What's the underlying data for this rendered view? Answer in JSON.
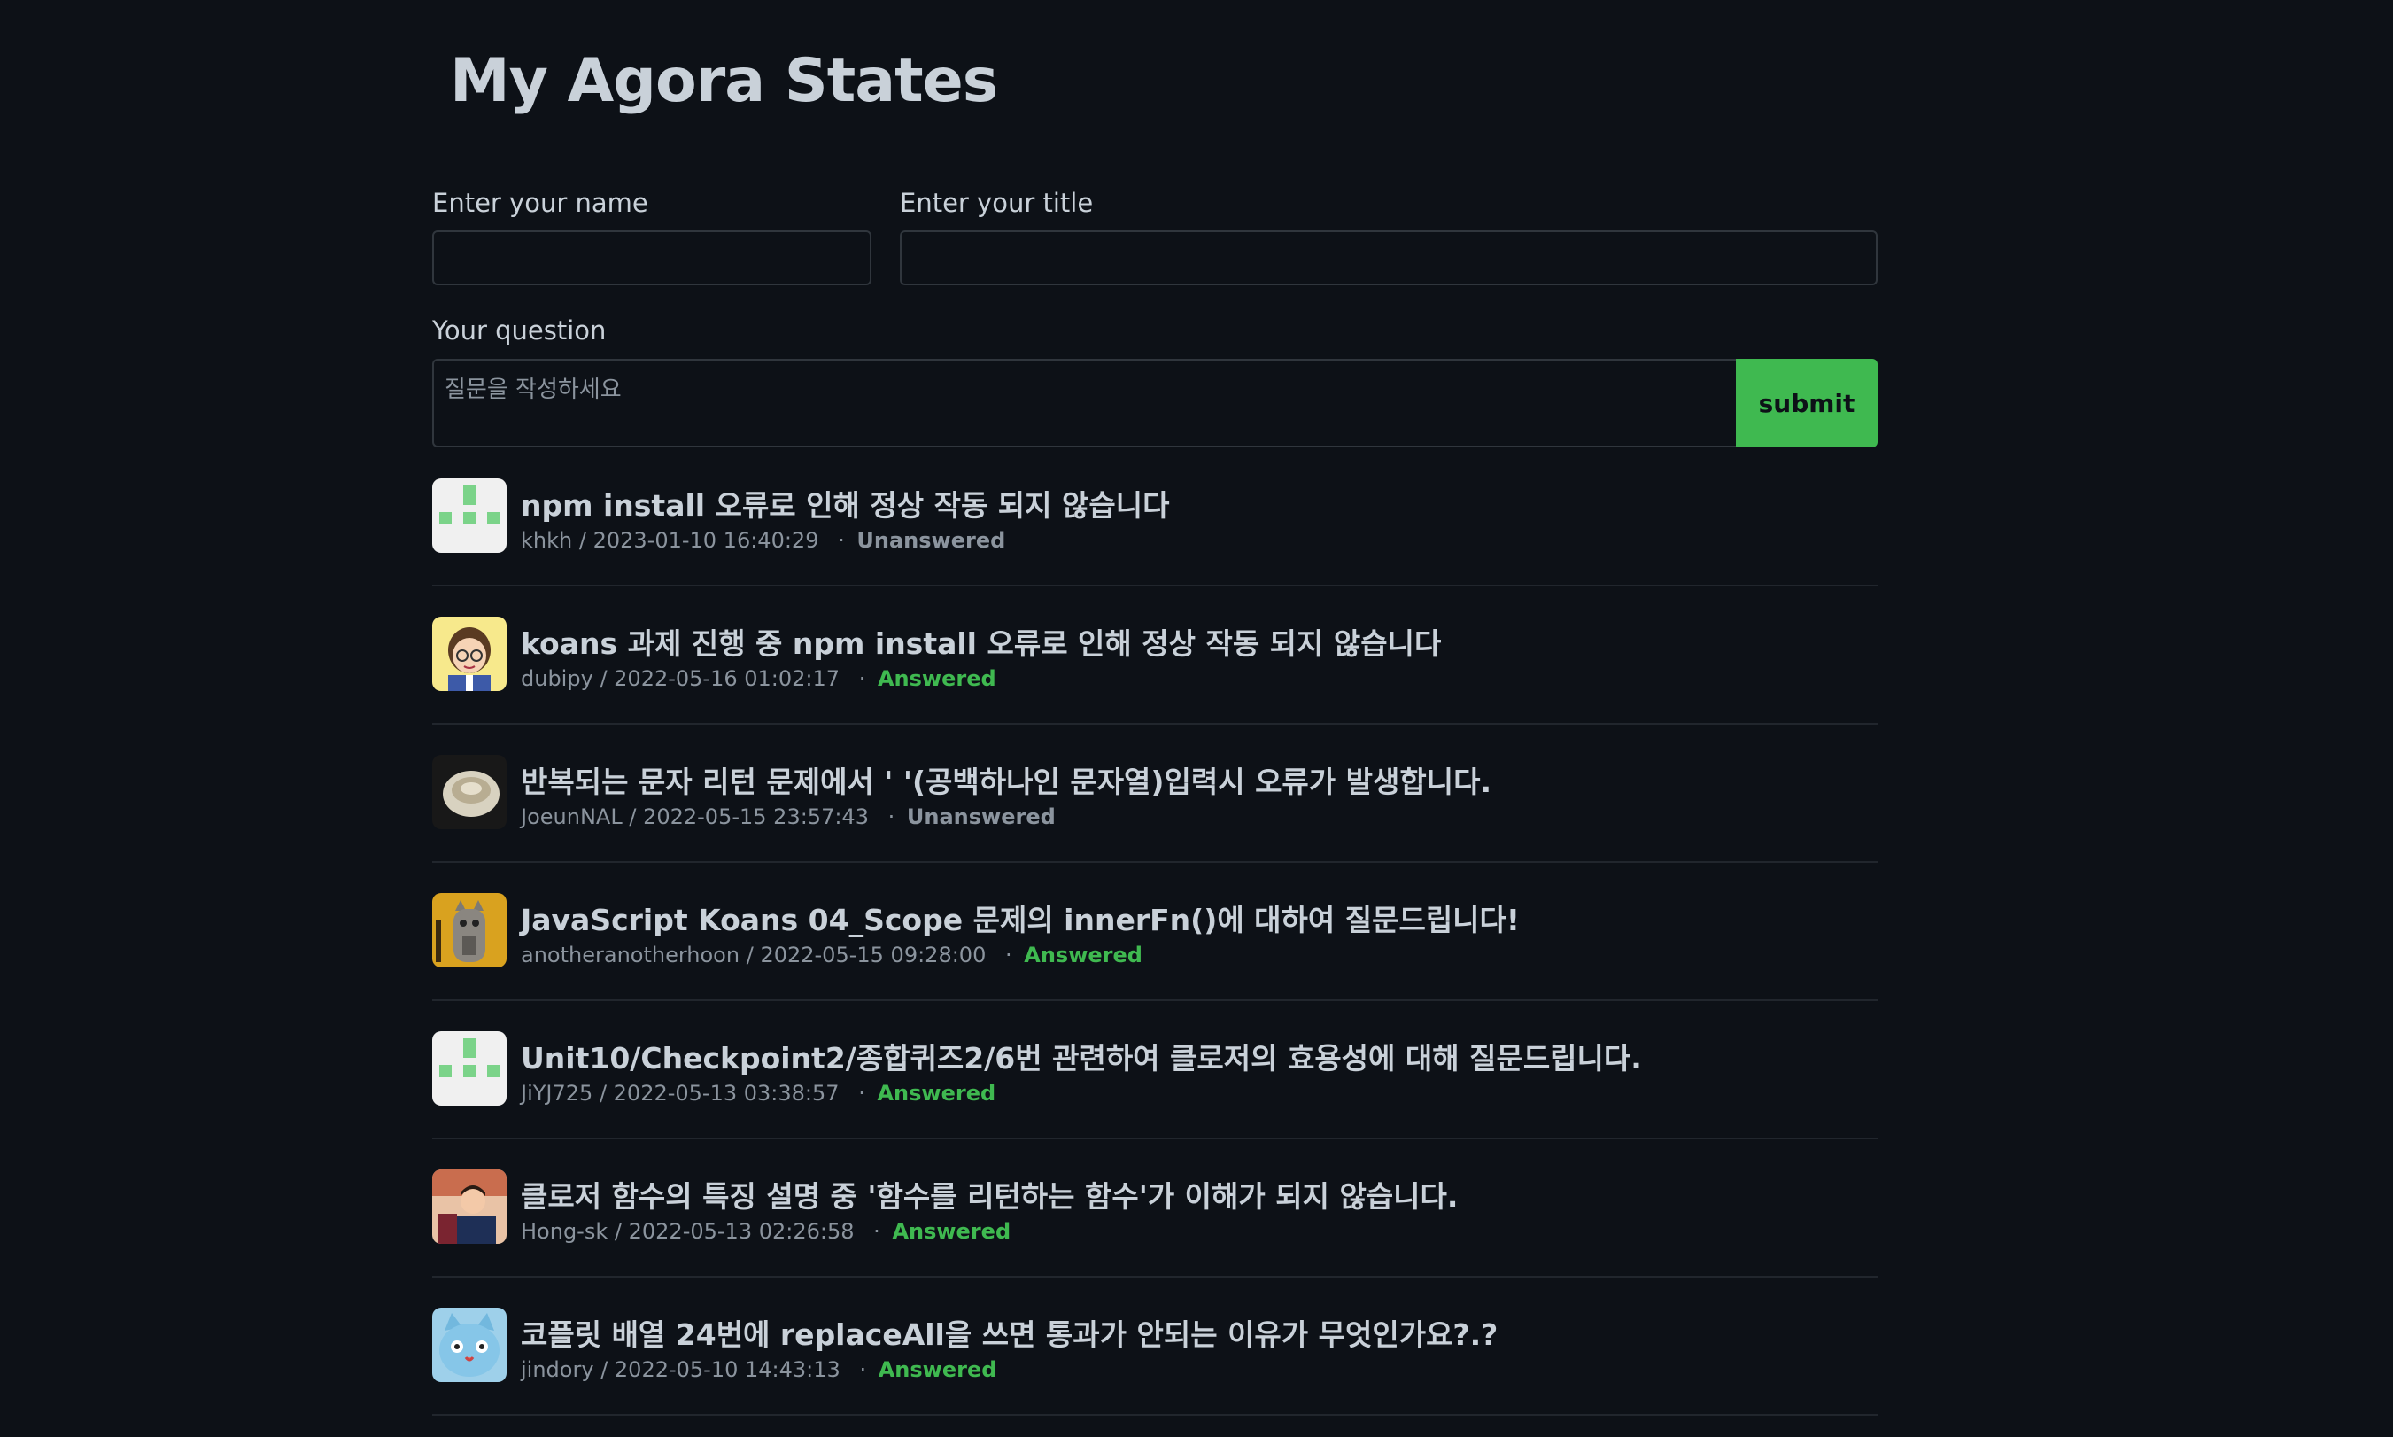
{
  "header": {
    "title": "My Agora States"
  },
  "form": {
    "name_label": "Enter your name",
    "name_value": "",
    "title_label": "Enter your title",
    "title_value": "",
    "question_label": "Your question",
    "question_placeholder": "질문을 작성하세요",
    "submit_label": "submit"
  },
  "separator": "·",
  "discussions": [
    {
      "title": "npm install 오류로 인해 정상 작동 되지 않습니다",
      "author": "khkh",
      "date": "2023-01-10 16:40:29",
      "status": "Unanswered",
      "avatar": "identicon-avatar"
    },
    {
      "title": "koans 과제 진행 중 npm install 오류로 인해 정상 작동 되지 않습니다",
      "author": "dubipy",
      "date": "2022-05-16 01:02:17",
      "status": "Answered",
      "avatar": "cartoon-boy-avatar"
    },
    {
      "title": "반복되는 문자 리턴 문제에서 ' '(공백하나인 문자열)입력시 오류가 발생합니다.",
      "author": "JoeunNAL",
      "date": "2022-05-15 23:57:43",
      "status": "Unanswered",
      "avatar": "bowl-avatar"
    },
    {
      "title": "JavaScript Koans 04_Scope 문제의 innerFn()에 대하여 질문드립니다!",
      "author": "anotheranotherhoon",
      "date": "2022-05-15 09:28:00",
      "status": "Answered",
      "avatar": "cat-avatar"
    },
    {
      "title": "Unit10/Checkpoint2/종합퀴즈2/6번 관련하여 클로저의 효용성에 대해 질문드립니다.",
      "author": "JiYJ725",
      "date": "2022-05-13 03:38:57",
      "status": "Answered",
      "avatar": "identicon-avatar"
    },
    {
      "title": "클로저 함수의 특징 설명 중 '함수를 리턴하는 함수'가 이해가 되지 않습니다.",
      "author": "Hong-sk",
      "date": "2022-05-13 02:26:58",
      "status": "Answered",
      "avatar": "person-photo-avatar"
    },
    {
      "title": "코플릿 배열 24번에 replaceAll을 쓰면 통과가 안되는 이유가 무엇인가요?.?",
      "author": "jindory",
      "date": "2022-05-10 14:43:13",
      "status": "Answered",
      "avatar": "blue-cat-avatar"
    }
  ],
  "colors": {
    "background": "#0d1117",
    "text": "#c9d1d9",
    "muted": "#8b949e",
    "accent": "#3fb950",
    "border": "#30363d"
  }
}
